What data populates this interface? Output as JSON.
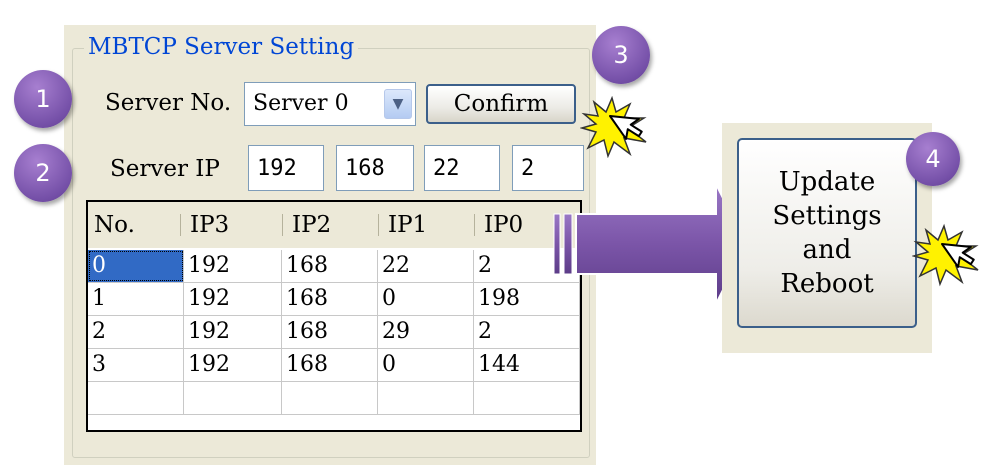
{
  "group": {
    "title": "MBTCP Server Setting"
  },
  "server_no": {
    "label": "Server No.",
    "selected": "Server 0"
  },
  "confirm": {
    "label": "Confirm"
  },
  "server_ip": {
    "label": "Server IP",
    "octets": [
      "192",
      "168",
      "22",
      "2"
    ]
  },
  "table": {
    "headers": [
      "No.",
      "IP3",
      "IP2",
      "IP1",
      "IP0"
    ],
    "rows": [
      [
        "0",
        "192",
        "168",
        "22",
        "2"
      ],
      [
        "1",
        "192",
        "168",
        "0",
        "198"
      ],
      [
        "2",
        "192",
        "168",
        "29",
        "2"
      ],
      [
        "3",
        "192",
        "168",
        "0",
        "144"
      ],
      [
        "",
        "",
        "",
        "",
        ""
      ]
    ]
  },
  "update_button": {
    "lines": [
      "Update",
      "Settings",
      "and",
      "Reboot"
    ]
  },
  "steps": [
    "1",
    "2",
    "3",
    "4"
  ],
  "colors": {
    "badge": "#7f56b2",
    "arrow": "#7b55a8",
    "group_title": "#0046d5",
    "selection": "#316ac5",
    "panel": "#ece9d8"
  },
  "icons": {
    "dropdown": "chevron-down-icon",
    "click": "click-cursor-icon",
    "arrow": "right-arrow-icon"
  }
}
